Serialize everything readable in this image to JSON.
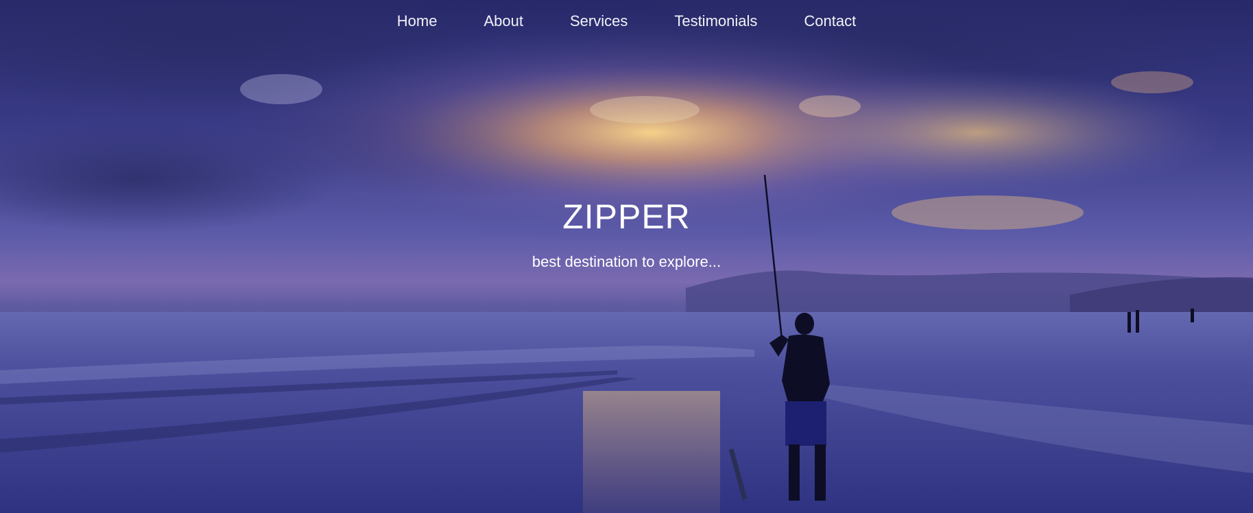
{
  "nav": {
    "items": [
      {
        "label": "Home"
      },
      {
        "label": "About"
      },
      {
        "label": "Services"
      },
      {
        "label": "Testimonials"
      },
      {
        "label": "Contact"
      }
    ]
  },
  "hero": {
    "title": "ZIPPER",
    "subtitle": "best destination to explore...",
    "image": "sunset-beach-fisherman-photo"
  },
  "colors": {
    "sky_top": "#2d2f70",
    "sky_mid": "#4a4a9a",
    "sunset_glow": "#f3c46a",
    "sea": "#3b3f8c",
    "text": "#ffffff"
  }
}
